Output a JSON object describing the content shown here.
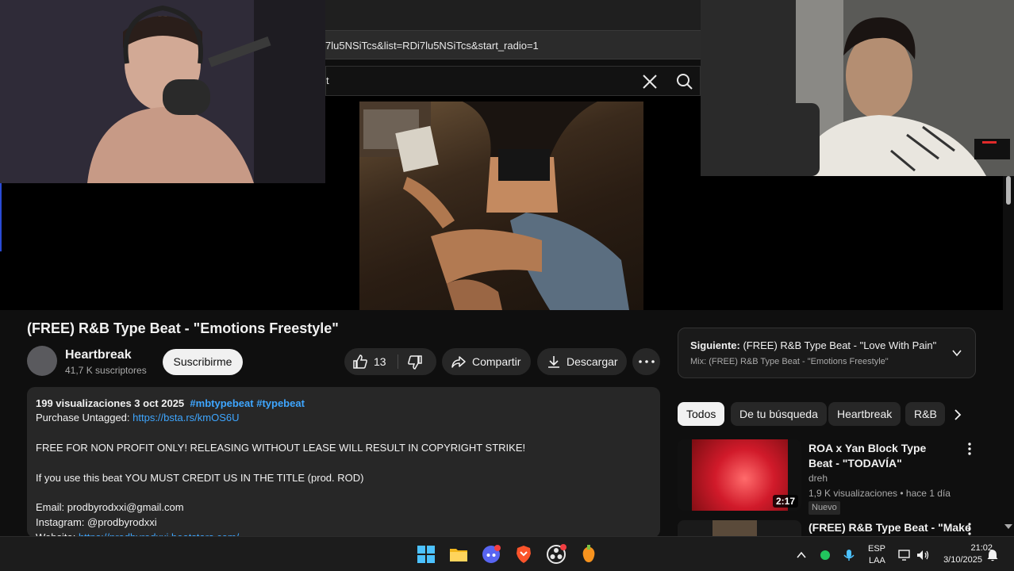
{
  "browser": {
    "url": "7lu5NSiTcs&list=RDi7lu5NSiTcs&start_radio=1",
    "search_value": "t"
  },
  "video": {
    "title": "(FREE) R&B Type Beat - \"Emotions Freestyle\"",
    "channel": {
      "name": "Heartbreak",
      "subscribers": "41,7 K suscriptores",
      "subscribe_label": "Suscribirme"
    },
    "actions": {
      "likes": "13",
      "share_label": "Compartir",
      "download_label": "Descargar"
    },
    "description": {
      "stats": "199 visualizaciones  3 oct 2025",
      "tags": "#mbtypebeat #typebeat",
      "purchase_prefix": "Purchase Untagged: ",
      "purchase_link": "https://bsta.rs/kmOS6U",
      "line_warning": "FREE FOR NON PROFIT ONLY! RELEASING WITHOUT LEASE WILL RESULT IN COPYRIGHT STRIKE!",
      "line_credit": "If you use this beat YOU MUST CREDIT US IN THE TITLE (prod. ROD)",
      "line_email": "Email: prodbyrodxxi@gmail.com",
      "line_instagram": "Instagram: @prodbyrodxxi",
      "website_prefix": "Website: ",
      "website_link": "https://prodbyrodxxi.beatstars.com/"
    }
  },
  "sidebar": {
    "up_next": {
      "prefix": "Siguiente: ",
      "title": "(FREE) R&B Type Beat - \"Love With Pain\"",
      "subtitle": "Mix: (FREE) R&B Type Beat - \"Emotions Freestyle\""
    },
    "chips": [
      "Todos",
      "De tu búsqueda",
      "Heartbreak",
      "R&B"
    ],
    "recommendations": [
      {
        "title": "ROA x Yan Block Type Beat - \"TODAVÍA\"",
        "channel": "dreh",
        "meta": "1,9 K visualizaciones • hace 1 día",
        "badge": "Nuevo",
        "duration": "2:17"
      },
      {
        "title": "(FREE) R&B Type Beat - \"Make"
      }
    ]
  },
  "taskbar": {
    "language_top": "ESP",
    "language_bottom": "LAA",
    "time": "21:02",
    "date": "3/10/2025",
    "icons": [
      "windows-start-icon",
      "file-explorer-icon",
      "discord-icon",
      "brave-icon",
      "obs-icon",
      "fl-studio-icon"
    ]
  },
  "colors": {
    "background": "#0f0f0f",
    "surface": "#272727",
    "link": "#3ea6ff",
    "text": "#f1f1f1",
    "muted": "#aaaaaa"
  }
}
